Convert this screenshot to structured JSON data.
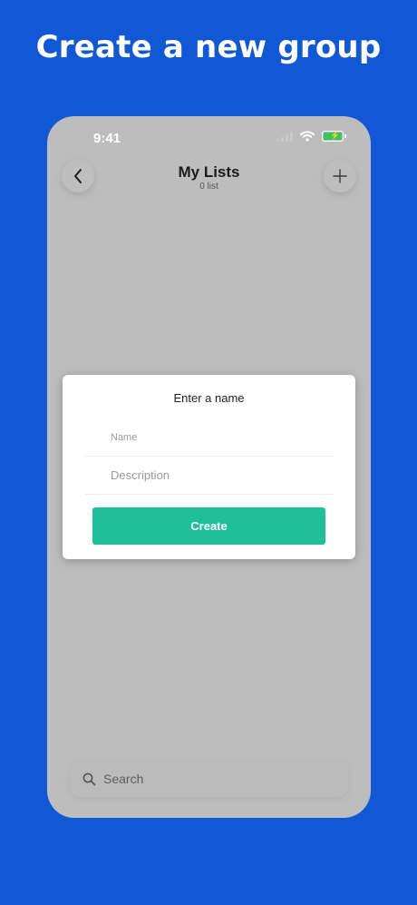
{
  "headline": "Create a new group",
  "status_bar": {
    "time": "9:41"
  },
  "nav": {
    "title": "My Lists",
    "subtitle": "0 list",
    "back_icon": "chevron-left-icon",
    "add_icon": "plus-icon"
  },
  "modal": {
    "title": "Enter a name",
    "name_placeholder": "Name",
    "description_placeholder": "Description",
    "create_label": "Create"
  },
  "search": {
    "placeholder": "Search",
    "icon": "search-icon"
  },
  "colors": {
    "background": "#1158d6",
    "phone_dimmed": "#bdbdbd",
    "accent": "#1fbf9a",
    "battery": "#34c759"
  }
}
